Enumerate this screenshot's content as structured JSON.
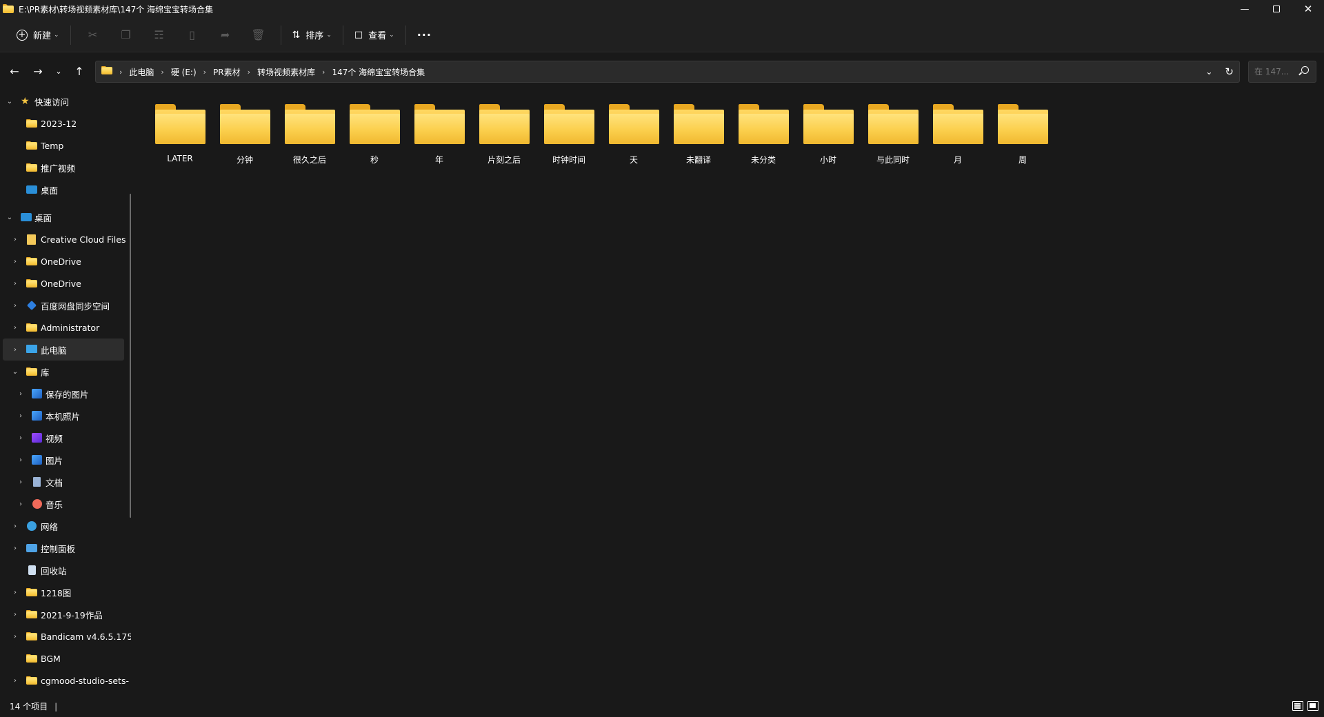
{
  "window": {
    "title": "E:\\PR素材\\转场视频素材库\\147个 海绵宝宝转场合集",
    "controls": [
      "minimize-icon",
      "restore-icon",
      "close-icon"
    ]
  },
  "toolbar": {
    "new_label": "新建",
    "sort_label": "排序",
    "view_label": "查看",
    "more_label": "···",
    "icons": [
      "cut-icon",
      "copy-icon",
      "paste-icon",
      "rename-icon",
      "share-icon",
      "delete-icon"
    ]
  },
  "nav": {
    "breadcrumb": [
      "此电脑",
      "硬 (E:)",
      "PR素材",
      "转场视频素材库",
      "147个 海绵宝宝转场合集"
    ],
    "search_placeholder": "在 147..."
  },
  "sidebar": {
    "quick_access": {
      "label": "快速访问",
      "items": [
        {
          "label": "2023-12",
          "icon": "folder"
        },
        {
          "label": "Temp",
          "icon": "folder"
        },
        {
          "label": "推广视频",
          "icon": "folder"
        },
        {
          "label": "桌面",
          "icon": "desktop"
        }
      ]
    },
    "desktop": {
      "label": "桌面",
      "items": [
        {
          "label": "Creative Cloud Files",
          "icon": "creative-cloud"
        },
        {
          "label": "OneDrive",
          "icon": "folder"
        },
        {
          "label": "OneDrive",
          "icon": "folder"
        },
        {
          "label": "百度网盘同步空间",
          "icon": "baidu"
        },
        {
          "label": "Administrator",
          "icon": "folder"
        },
        {
          "label": "此电脑",
          "icon": "monitor"
        },
        {
          "label": "库",
          "icon": "folder"
        }
      ],
      "library": [
        {
          "label": "保存的图片",
          "icon": "gallery"
        },
        {
          "label": "本机照片",
          "icon": "gallery"
        },
        {
          "label": "视频",
          "icon": "video"
        },
        {
          "label": "图片",
          "icon": "gallery"
        },
        {
          "label": "文档",
          "icon": "document"
        },
        {
          "label": "音乐",
          "icon": "music"
        }
      ],
      "after": [
        {
          "label": "网络",
          "icon": "network"
        },
        {
          "label": "控制面板",
          "icon": "control-panel"
        },
        {
          "label": "回收站",
          "icon": "recycle-bin"
        },
        {
          "label": "1218图",
          "icon": "folder"
        },
        {
          "label": "2021-9-19作品",
          "icon": "folder"
        },
        {
          "label": "Bandicam  v4.6.5.175",
          "icon": "folder"
        },
        {
          "label": "BGM",
          "icon": "folder"
        },
        {
          "label": "cgmood-studio-sets-",
          "icon": "folder"
        }
      ]
    }
  },
  "content": {
    "folders": [
      "LATER",
      "分钟",
      "很久之后",
      "秒",
      "年",
      "片刻之后",
      "时钟时间",
      "天",
      "未翻译",
      "未分类",
      "小时",
      "与此同时",
      "月",
      "周"
    ]
  },
  "status": {
    "item_count": "14 个项目",
    "separator": "|"
  },
  "colors": {
    "background": "#191919",
    "chrome": "#202020",
    "folder_yellow": "#f7c23a",
    "selected": "#2d2d2d"
  }
}
